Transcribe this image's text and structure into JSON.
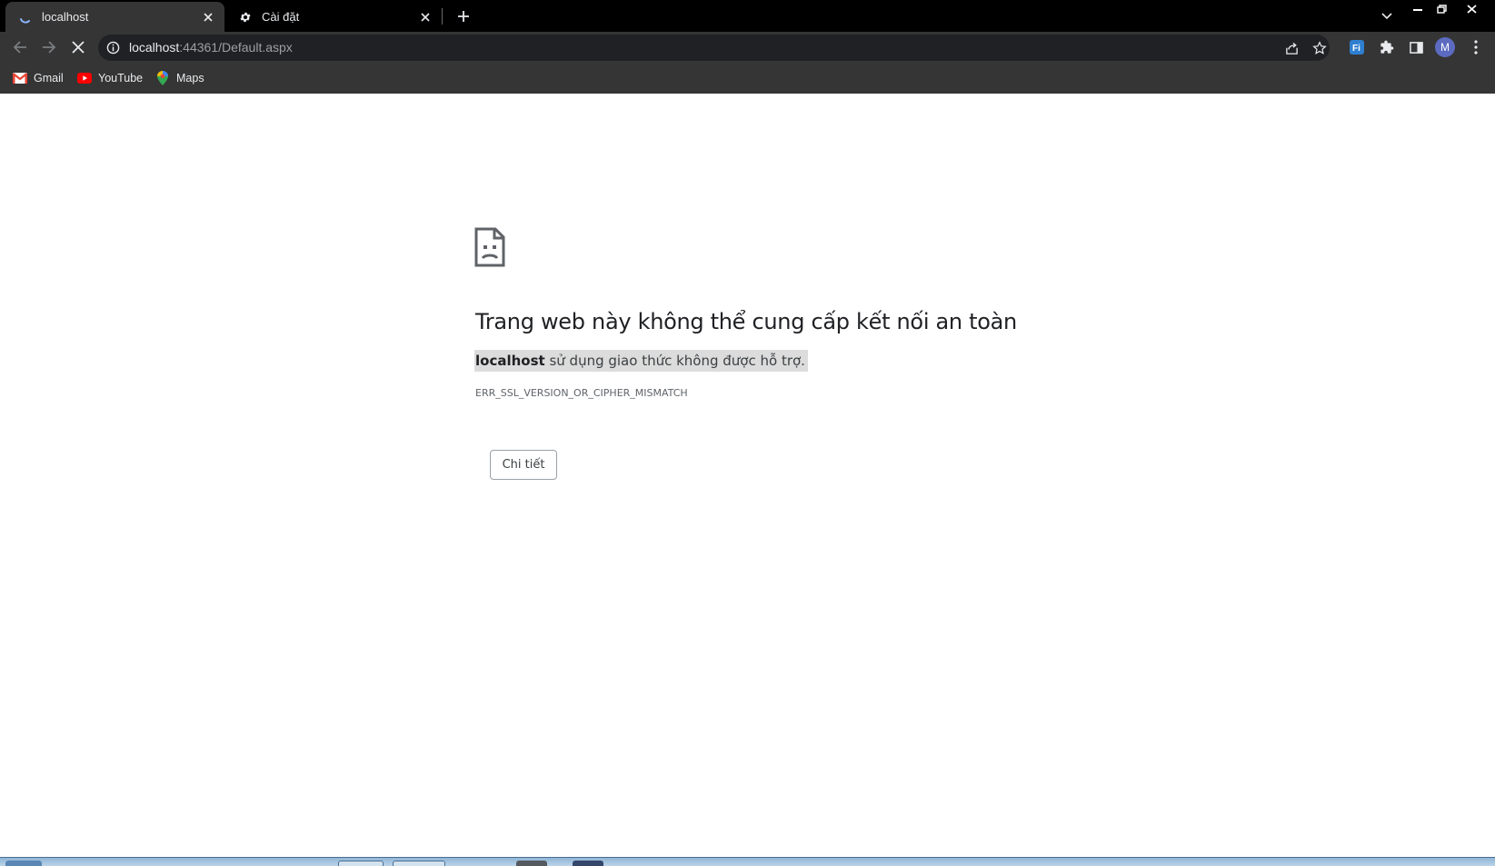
{
  "tabs": [
    {
      "title": "localhost",
      "icon": "loading-spinner-icon",
      "active": true
    },
    {
      "title": "Cài đặt",
      "icon": "gear-icon",
      "active": false
    }
  ],
  "omnibox": {
    "host": "localhost",
    "path": ":44361/Default.aspx"
  },
  "profile": {
    "initial": "M",
    "color": "#5c6bc0"
  },
  "bookmarks": [
    {
      "label": "Gmail",
      "icon": "gmail-icon"
    },
    {
      "label": "YouTube",
      "icon": "youtube-icon"
    },
    {
      "label": "Maps",
      "icon": "maps-icon"
    }
  ],
  "error": {
    "title": "Trang web này không thể cung cấp kết nối an toàn",
    "desc_host": "localhost",
    "desc_rest": " sử dụng giao thức không được hỗ trợ.",
    "code": "ERR_SSL_VERSION_OR_CIPHER_MISMATCH",
    "details_label": "Chi tiết"
  },
  "colors": {
    "tabstrip": "#000000",
    "toolbar": "#353535",
    "omnibox": "#202124",
    "highlight": "#dcdcdc"
  }
}
